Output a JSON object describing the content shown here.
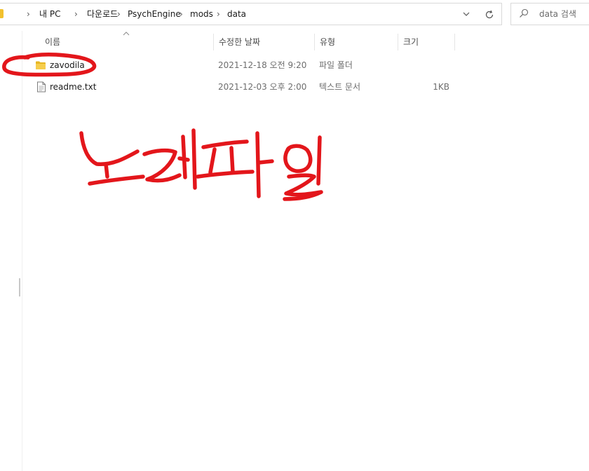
{
  "breadcrumb": {
    "items": [
      "내 PC",
      "다운로드",
      "PsychEngine",
      "mods",
      "data"
    ],
    "separator": "›"
  },
  "search": {
    "placeholder": "data 검색"
  },
  "columns": {
    "name": "이름",
    "date_modified": "수정한 날짜",
    "type": "유형",
    "size": "크기"
  },
  "files": [
    {
      "name": "zavodila",
      "date_modified": "2021-12-18 오전 9:20",
      "type": "파일 폴더",
      "size": "",
      "icon": "folder-icon"
    },
    {
      "name": "readme.txt",
      "date_modified": "2021-12-03 오후 2:00",
      "type": "텍스트 문서",
      "size": "1KB",
      "icon": "text-file-icon"
    }
  ],
  "annotation": {
    "handwritten_text": "노래파일",
    "color": "#e3161b",
    "circled_item": "zavodila"
  },
  "colors": {
    "folder": "#f2c12e",
    "annotation_red": "#e3161b",
    "border": "#d9d9d9"
  }
}
